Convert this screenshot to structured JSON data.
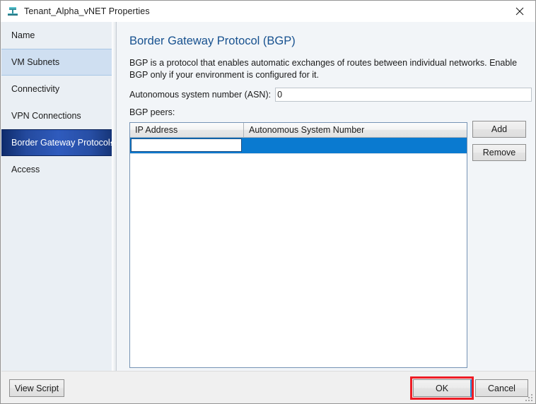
{
  "window": {
    "title": "Tenant_Alpha_vNET Properties",
    "icon": "network-vnet-icon",
    "close_label": "✕"
  },
  "sidebar": {
    "items": [
      {
        "label": "Name",
        "state": "normal"
      },
      {
        "label": "VM Subnets",
        "state": "hover"
      },
      {
        "label": "Connectivity",
        "state": "normal"
      },
      {
        "label": "VPN Connections",
        "state": "normal"
      },
      {
        "label": "Border Gateway Protocol...",
        "state": "selected"
      },
      {
        "label": "Access",
        "state": "normal"
      }
    ]
  },
  "main": {
    "page_title": "Border Gateway Protocol (BGP)",
    "description": "BGP is a protocol that enables automatic exchanges of routes between individual networks. Enable BGP only if your environment is configured for it.",
    "asn": {
      "label": "Autonomous system number (ASN):",
      "value": "0",
      "placeholder": ""
    },
    "peers_label": "BGP peers:",
    "grid": {
      "columns": [
        "IP Address",
        "Autonomous System Number"
      ],
      "rows": [
        {
          "ip_address": "",
          "asn": "",
          "selected": true,
          "editing": true
        }
      ],
      "edit_placeholder": ""
    },
    "buttons": {
      "add": "Add",
      "remove": "Remove"
    }
  },
  "footer": {
    "view_script": "View Script",
    "ok": "OK",
    "cancel": "Cancel"
  },
  "colors": {
    "title_accent": "#17518f",
    "selection_blue": "#0a7ad0",
    "nav_selected_blue": "#2f5bbd",
    "nav_hover_blue": "#cfdff1",
    "highlight_red": "#ee1c25",
    "grid_border": "#7593b4"
  }
}
